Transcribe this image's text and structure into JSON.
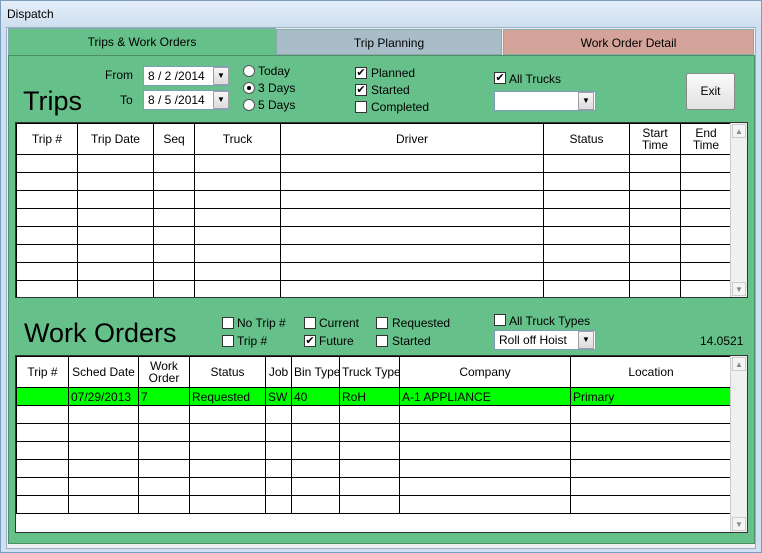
{
  "window": {
    "title": "Dispatch"
  },
  "tabs": [
    "Trips & Work Orders",
    "Trip Planning",
    "Work Order Detail"
  ],
  "trips": {
    "heading": "Trips",
    "from_label": "From",
    "from_value": "8 / 2 /2014",
    "to_label": "To",
    "to_value": "8 / 5 /2014",
    "range_options": [
      {
        "label": "Today",
        "selected": false
      },
      {
        "label": "3 Days",
        "selected": true
      },
      {
        "label": "5 Days",
        "selected": false
      }
    ],
    "status_filters": [
      {
        "label": "Planned",
        "checked": true
      },
      {
        "label": "Started",
        "checked": true
      },
      {
        "label": "Completed",
        "checked": false
      }
    ],
    "all_trucks_label": "All Trucks",
    "all_trucks_checked": true,
    "truck_select_value": "",
    "exit_label": "Exit",
    "columns": [
      "Trip #",
      "Trip Date",
      "Seq",
      "Truck",
      "Driver",
      "Status",
      "Start Time",
      "End Time"
    ]
  },
  "work_orders": {
    "heading": "Work Orders",
    "filters": [
      {
        "label": "No Trip #",
        "checked": false
      },
      {
        "label": "Trip #",
        "checked": false
      },
      {
        "label": "Current",
        "checked": false
      },
      {
        "label": "Future",
        "checked": true
      },
      {
        "label": "Requested",
        "checked": false
      },
      {
        "label": "Started",
        "checked": false
      }
    ],
    "all_truck_types_label": "All Truck Types",
    "all_truck_types_checked": false,
    "truck_type_select_value": "Roll off Hoist",
    "version": "14.0521",
    "columns": [
      "Trip #",
      "Sched Date",
      "Work Order",
      "Status",
      "Job",
      "Bin Type",
      "Truck Type",
      "Company",
      "Location"
    ],
    "rows": [
      {
        "trip": "",
        "sched_date": "07/29/2013",
        "work_order": "7",
        "status": "Requested",
        "job": "SW",
        "bin_type": "40",
        "truck_type": "RoH",
        "company": "A-1 APPLIANCE",
        "location": "Primary"
      }
    ]
  },
  "colors": {
    "panel": "#66c08a",
    "highlight": "#00ff00"
  }
}
